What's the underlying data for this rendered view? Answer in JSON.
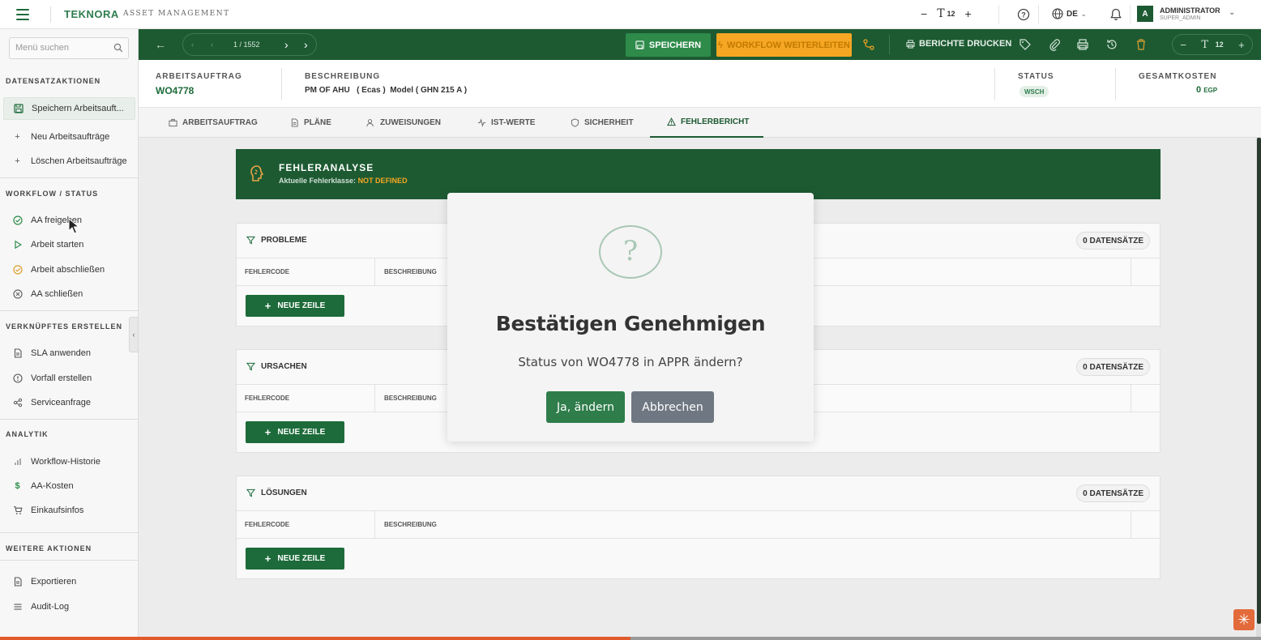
{
  "app": {
    "logo": "TEKNORA",
    "logo_sub": "ASSET MANAGEMENT",
    "font_size": "12",
    "language": "DE",
    "user_name": "ADMINISTRATOR",
    "user_role": "SUPER_ADMIN",
    "avatar_letter": "A"
  },
  "sidebar": {
    "search_placeholder": "Menü suchen",
    "sections": {
      "record_actions": "DATENSATZAKTIONEN",
      "workflow": "WORKFLOW / STATUS",
      "linked": "VERKNÜPFTES ERSTELLEN",
      "analytics": "ANALYTIK",
      "more": "WEITERE AKTIONEN"
    },
    "items": {
      "save": "Speichern Arbeitsauft...",
      "new": "Neu Arbeitsaufträge",
      "delete": "Löschen Arbeitsaufträge",
      "approve": "AA freigeben",
      "start": "Arbeit starten",
      "finish": "Arbeit abschließen",
      "close": "AA schließen",
      "sla": "SLA anwenden",
      "incident": "Vorfall erstellen",
      "service": "Serviceanfrage",
      "history": "Workflow-Historie",
      "costs": "AA-Kosten",
      "purchase": "Einkaufsinfos",
      "export": "Exportieren",
      "audit": "Audit-Log"
    }
  },
  "toolbar": {
    "pager": "1 / 1552",
    "save_label": "SPEICHERN",
    "workflow_label": "WORKFLOW WEITERLEITEN",
    "print_label": "BERICHTE DRUCKEN",
    "font_size": "12"
  },
  "record": {
    "type_label": "ARBEITSAUFTRAG",
    "id": "WO4778",
    "desc_label": "BESCHREIBUNG",
    "description": "PM OF AHU   ( Ecas )  Model ( GHN 215 A )",
    "status_label": "STATUS",
    "status": "WSCH",
    "cost_label": "GESAMTKOSTEN",
    "cost_value": "0",
    "cost_currency": "EGP"
  },
  "tabs": {
    "t1": "ARBEITSAUFTRAG",
    "t2": "PLÄNE",
    "t3": "ZUWEISUNGEN",
    "t4": "IST-WERTE",
    "t5": "SICHERHEIT",
    "t6": "FEHLERBERICHT"
  },
  "failure": {
    "title": "FEHLERANALYSE",
    "sub_label": "Aktuelle Fehlerklasse:",
    "sub_value": "NOT DEFINED"
  },
  "panels": {
    "problems": "PROBLEME",
    "causes": "URSACHEN",
    "solutions": "LÖSUNGEN",
    "records": "0 DATENSÄTZE",
    "col_code": "FEHLERCODE",
    "col_desc": "BESCHREIBUNG",
    "new_row": "NEUE ZEILE"
  },
  "modal": {
    "icon": "?",
    "title": "Bestätigen Genehmigen",
    "text": "Status von WO4778 in APPR ändern?",
    "confirm": "Ja, ändern",
    "cancel": "Abbrechen"
  },
  "colors": {
    "primary": "#1d5a32",
    "accent": "#f5a623",
    "button_green": "#2e7d4a",
    "cancel_gray": "#6f7882"
  }
}
